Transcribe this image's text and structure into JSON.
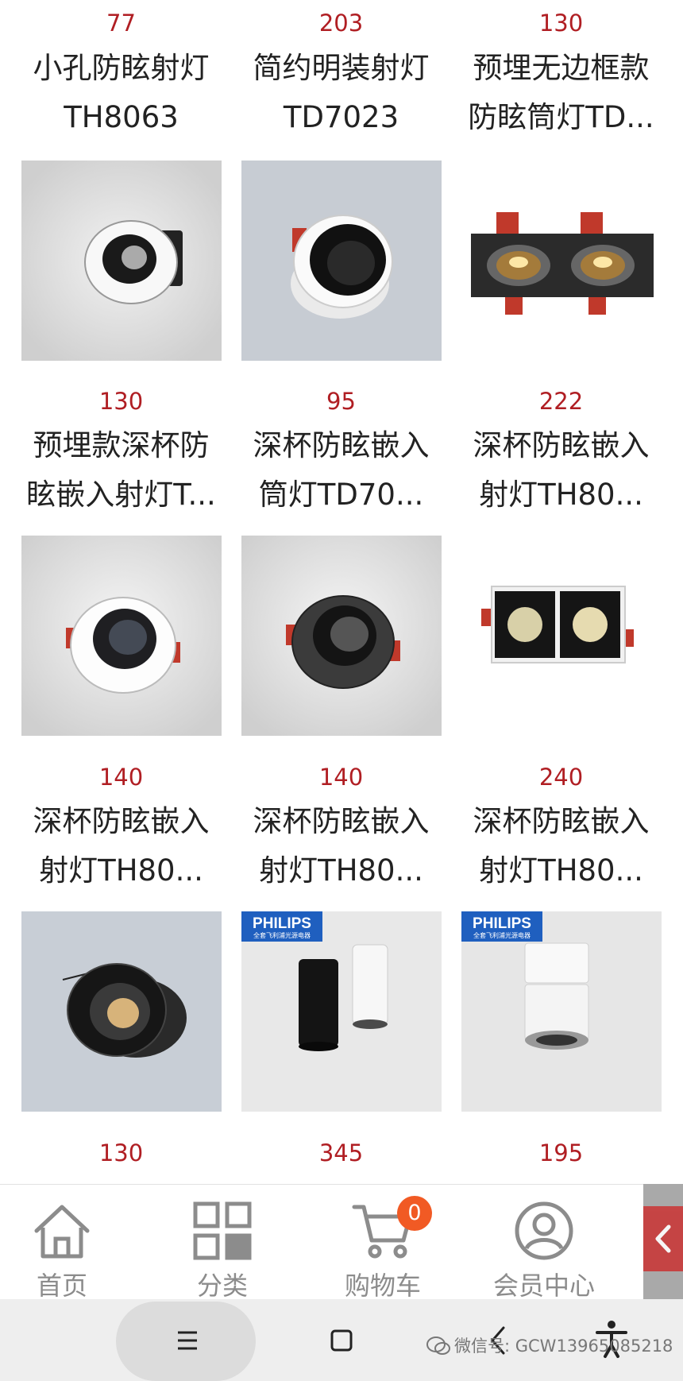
{
  "products": [
    {
      "price": "77",
      "name": "小孔防眩射灯\nTH8063"
    },
    {
      "price": "203",
      "name": "简约明装射灯\nTD7023"
    },
    {
      "price": "130",
      "name": "预埋无边框款\n防眩筒灯TD..."
    },
    {
      "price": "130",
      "name": "预埋款深杯防\n眩嵌入射灯T..."
    },
    {
      "price": "95",
      "name": "深杯防眩嵌入\n筒灯TD70..."
    },
    {
      "price": "222",
      "name": "深杯防眩嵌入\n射灯TH80..."
    },
    {
      "price": "140",
      "name": "深杯防眩嵌入\n射灯TH80..."
    },
    {
      "price": "140",
      "name": "深杯防眩嵌入\n射灯TH80..."
    },
    {
      "price": "240",
      "name": "深杯防眩嵌入\n射灯TH80..."
    },
    {
      "price": "130",
      "name": ""
    },
    {
      "price": "345",
      "name": ""
    },
    {
      "price": "195",
      "name": ""
    }
  ],
  "thumbnails": [
    {
      "icon": "round-white-downlight-icon"
    },
    {
      "icon": "round-white-black-cup-downlight-icon"
    },
    {
      "icon": "double-head-black-grille-light-icon"
    },
    {
      "icon": "white-deep-cup-spotlight-icon"
    },
    {
      "icon": "black-deep-cup-spotlight-icon"
    },
    {
      "icon": "double-square-grille-light-icon"
    },
    {
      "icon": "black-deep-cup-downlight-icon"
    },
    {
      "icon": "philips-cylinder-lights-icon",
      "brand": "PHILIPS",
      "brand_sub": "全套飞利浦光源电器"
    },
    {
      "icon": "philips-surface-spotlight-icon",
      "brand": "PHILIPS",
      "brand_sub": "全套飞利浦光源电器"
    }
  ],
  "tabbar": {
    "home": "首页",
    "category": "分类",
    "cart": "购物车",
    "cart_count": "0",
    "member": "会员中心"
  },
  "watermark": "微信号: GCW13965085218",
  "colors": {
    "price": "#b01e23",
    "badge": "#f15a24",
    "tab_label": "#8c8c8c"
  }
}
